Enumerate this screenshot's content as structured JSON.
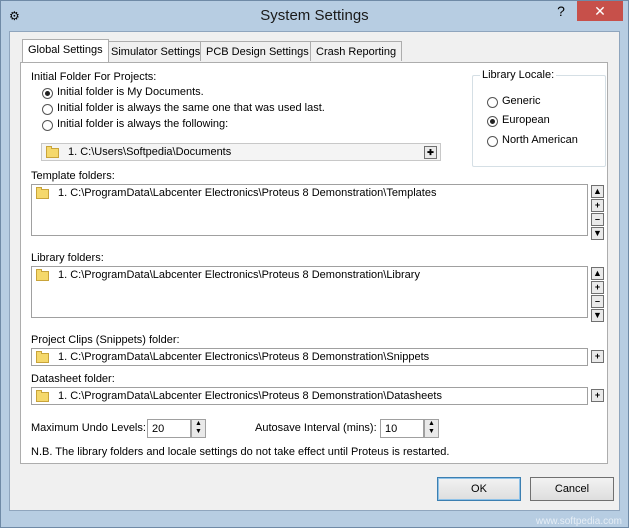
{
  "window": {
    "title": "System Settings",
    "help_glyph": "?",
    "close_glyph": "✕"
  },
  "tabs": [
    {
      "label": "Global Settings"
    },
    {
      "label": "Simulator Settings"
    },
    {
      "label": "PCB Design Settings"
    },
    {
      "label": "Crash Reporting"
    }
  ],
  "initial_folder": {
    "label": "Initial Folder For Projects:",
    "options": [
      {
        "label": "Initial folder is My Documents.",
        "selected": true
      },
      {
        "label": "Initial folder is always the same one that was used last.",
        "selected": false
      },
      {
        "label": "Initial folder is always the following:",
        "selected": false
      }
    ],
    "path": "1.  C:\\Users\\Softpedia\\Documents"
  },
  "library_locale": {
    "label": "Library Locale:",
    "options": [
      {
        "label": "Generic",
        "selected": false
      },
      {
        "label": "European",
        "selected": true
      },
      {
        "label": "North American",
        "selected": false
      }
    ]
  },
  "template_folders": {
    "label": "Template folders:",
    "items": [
      "1.  C:\\ProgramData\\Labcenter Electronics\\Proteus 8 Demonstration\\Templates"
    ]
  },
  "library_folders": {
    "label": "Library folders:",
    "items": [
      "1.  C:\\ProgramData\\Labcenter Electronics\\Proteus 8 Demonstration\\Library"
    ]
  },
  "project_clips": {
    "label": "Project Clips (Snippets) folder:",
    "path": "1.  C:\\ProgramData\\Labcenter Electronics\\Proteus 8 Demonstration\\Snippets"
  },
  "datasheet": {
    "label": "Datasheet folder:",
    "path": "1.  C:\\ProgramData\\Labcenter Electronics\\Proteus 8 Demonstration\\Datasheets"
  },
  "undo": {
    "label": "Maximum Undo Levels:",
    "value": "20"
  },
  "autosave": {
    "label": "Autosave Interval (mins):",
    "value": "10"
  },
  "note": "N.B. The library folders and locale settings do not take effect until Proteus is restarted.",
  "buttons": {
    "ok": "OK",
    "cancel": "Cancel"
  },
  "watermark": "www.softpedia.com"
}
